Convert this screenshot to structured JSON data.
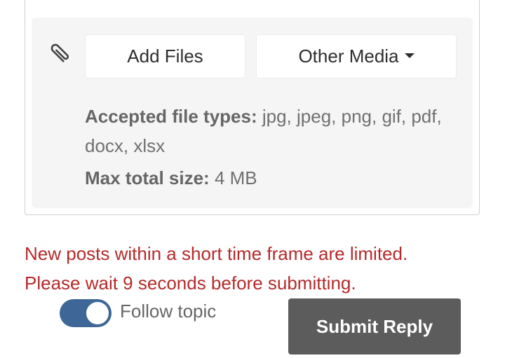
{
  "attachments": {
    "add_files_label": "Add Files",
    "other_media_label": "Other Media",
    "accepted_label": "Accepted file types:",
    "accepted_value": " jpg, jpeg, png, gif, pdf, docx, xlsx",
    "max_label": "Max total size:",
    "max_value": " 4 MB"
  },
  "warning": {
    "line1": "New posts within a short time frame are limited.",
    "line2": "Please wait 9 seconds before submitting."
  },
  "follow": {
    "label": "Follow topic",
    "enabled": true
  },
  "submit": {
    "label": "Submit Reply"
  },
  "colors": {
    "warning": "#b52a2a",
    "toggle_on": "#3e6696",
    "submit_bg": "#5c5c5c"
  },
  "icons": {
    "attach": "paperclip-icon",
    "dropdown": "caret-down-icon"
  }
}
